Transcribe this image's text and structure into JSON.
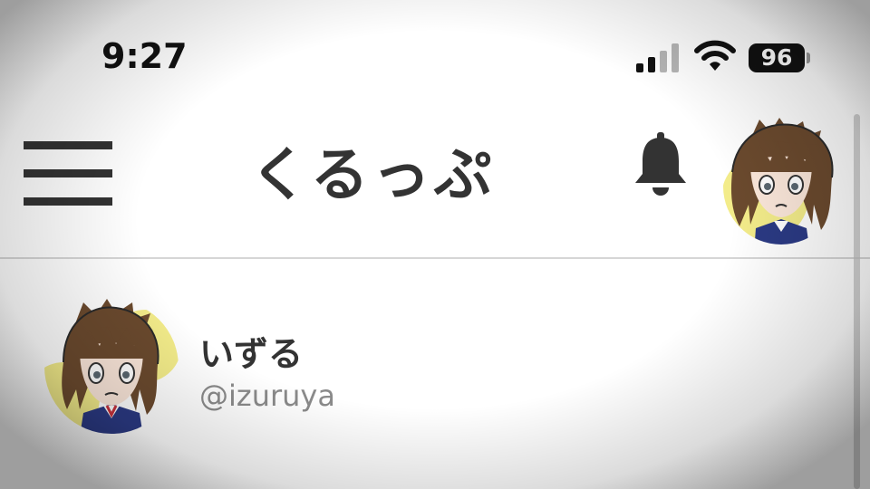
{
  "status_bar": {
    "time": "9:27",
    "battery_level": "96",
    "signal_bars_active": 2,
    "signal_bars_total": 4,
    "icons": [
      "cellular-signal-icon",
      "wifi-icon",
      "battery-icon"
    ]
  },
  "header": {
    "title": "くるっぷ",
    "icons": [
      "hamburger-menu-icon",
      "bell-icon",
      "user-avatar"
    ]
  },
  "profile": {
    "display_name": "いずる",
    "handle": "@izuruya"
  },
  "colors": {
    "text_primary": "#333333",
    "text_secondary": "#8a8a8a",
    "divider": "#d6d6d6",
    "avatar_background": "#f3ec8a",
    "status_text": "#111111"
  }
}
